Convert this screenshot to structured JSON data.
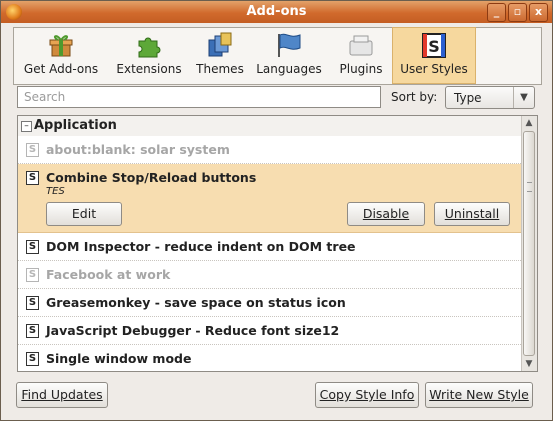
{
  "window": {
    "title": "Add-ons"
  },
  "title_buttons": [
    "_",
    "▫",
    "x"
  ],
  "toolbar": [
    {
      "label": "Get Add-ons",
      "icon": "gift-box-icon"
    },
    {
      "label": "Extensions",
      "icon": "puzzle-piece-icon"
    },
    {
      "label": "Themes",
      "icon": "themes-icon"
    },
    {
      "label": "Languages",
      "icon": "language-flag-icon"
    },
    {
      "label": "Plugins",
      "icon": "plugin-block-icon"
    },
    {
      "label": "User Styles",
      "icon": "stylish-s-icon",
      "selected": true
    }
  ],
  "search": {
    "placeholder": "Search"
  },
  "sort": {
    "label": "Sort by:",
    "value": "Type"
  },
  "group": {
    "toggle": "–",
    "label": "Application"
  },
  "style_icon_glyph": "S",
  "items": [
    {
      "name": "about:blank: solar system",
      "enabled": false
    },
    {
      "name": "Combine Stop/Reload buttons",
      "enabled": true,
      "author": "TES",
      "selected": true
    },
    {
      "name": "DOM Inspector - reduce indent on DOM tree",
      "enabled": true
    },
    {
      "name": "Facebook at work",
      "enabled": false
    },
    {
      "name": "Greasemonkey - save space on status icon",
      "enabled": true
    },
    {
      "name": "JavaScript Debugger - Reduce font size12",
      "enabled": true
    },
    {
      "name": "Single window mode",
      "enabled": true
    }
  ],
  "selected_item_buttons": {
    "edit": "Edit",
    "disable": "Disable",
    "uninstall": "Uninstall"
  },
  "footer": {
    "find_updates": "Find Updates",
    "copy_style_info": "Copy Style Info",
    "write_new_style": "Write New Style"
  },
  "colors": {
    "titlebar": "#d16a2c",
    "selection": "#f7ddb0",
    "toolbar_selected": "#f6d89e"
  }
}
